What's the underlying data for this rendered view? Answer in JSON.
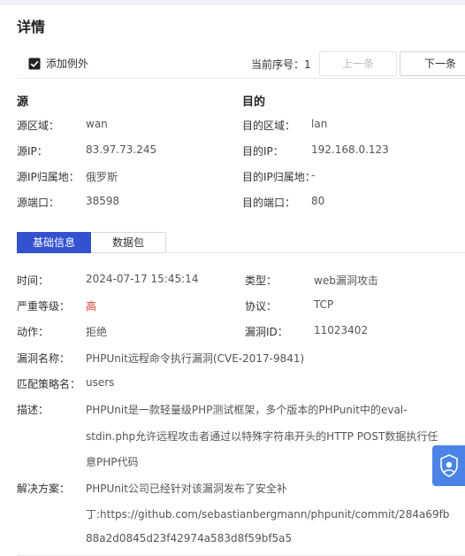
{
  "header": {
    "title": "详情"
  },
  "toolbar": {
    "add_exception_label": "添加例外",
    "current_seq_label": "当前序号：",
    "current_seq_value": "1",
    "prev_label": "上一条",
    "next_label": "下一条"
  },
  "source": {
    "title": "源",
    "zone": {
      "label": "源区域：",
      "value": "wan"
    },
    "ip": {
      "label": "源IP：",
      "value": "83.97.73.245"
    },
    "ip_location": {
      "label": "源IP归属地：",
      "value": "俄罗斯"
    },
    "port": {
      "label": "源端口：",
      "value": "38598"
    }
  },
  "destination": {
    "title": "目的",
    "zone": {
      "label": "目的区域：",
      "value": "lan"
    },
    "ip": {
      "label": "目的IP：",
      "value": "192.168.0.123"
    },
    "ip_location": {
      "label": "目的IP归属地：",
      "value": "-"
    },
    "port": {
      "label": "目的端口：",
      "value": "80"
    }
  },
  "tabs": [
    {
      "label": "基础信息",
      "active": true
    },
    {
      "label": "数据包",
      "active": false
    }
  ],
  "info": {
    "time": {
      "label": "时间：",
      "value": "2024-07-17 15:45:14"
    },
    "type": {
      "label": "类型：",
      "value": "web漏洞攻击"
    },
    "severity": {
      "label": "严重等级：",
      "value": "高",
      "color": "#d9312d"
    },
    "protocol": {
      "label": "协议：",
      "value": "TCP"
    },
    "action": {
      "label": "动作：",
      "value": "拒绝"
    },
    "vuln_id": {
      "label": "漏洞ID：",
      "value": "11023402"
    },
    "vuln_name": {
      "label": "漏洞名称：",
      "value": "PHPUnit远程命令执行漏洞(CVE-2017-9841)"
    },
    "policy": {
      "label": "匹配策略名：",
      "value": "users"
    },
    "description": {
      "label": "描述：",
      "lines": [
        "PHPUnit是一款轻量级PHP测试框架，多个版本的PHPunit中的eval-",
        "stdin.php允许远程攻击者通过以特殊字符串开头的HTTP POST数据执行任",
        "意PHP代码"
      ]
    },
    "solution": {
      "label": "解决方案：",
      "lines": [
        "PHPUnit公司已经针对该漏洞发布了安全补",
        "丁:https://github.com/sebastianbergmann/phpunit/commit/284a69fb",
        "88a2d0845d23f42974a583d8f59bf5a5"
      ]
    }
  },
  "colors": {
    "accent": "#3451d1",
    "danger": "#d9312d",
    "float_button": "#4b84e6"
  },
  "float_button": {
    "icon": "assistant-icon"
  }
}
